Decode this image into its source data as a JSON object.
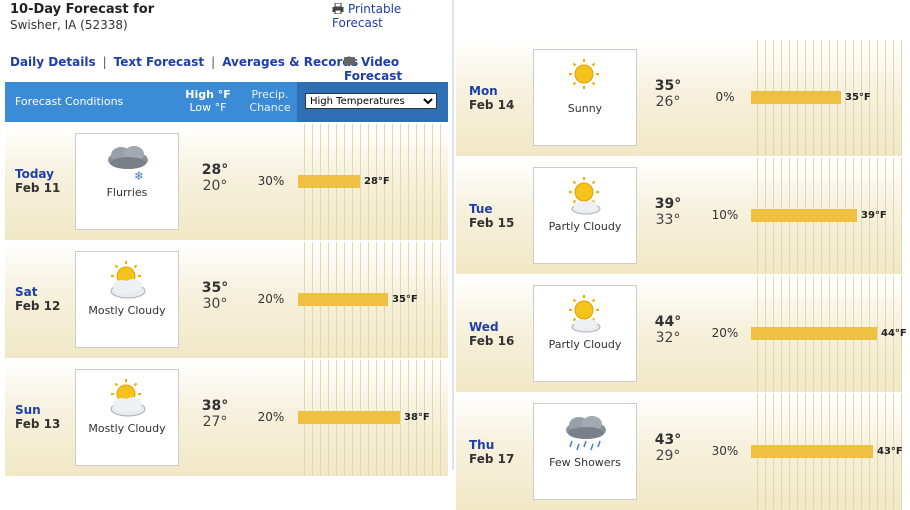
{
  "header": {
    "title": "10-Day Forecast for",
    "location": "Swisher, IA (52338)",
    "printable": "Printable Forecast"
  },
  "nav": {
    "daily": "Daily Details",
    "text": "Text Forecast",
    "averages": "Averages & Records",
    "video": "Video Forecast",
    "sep": "|"
  },
  "table_header": {
    "conditions": "Forecast Conditions",
    "high": "High °F",
    "low": "Low °F",
    "precip1": "Precip.",
    "precip2": "Chance",
    "select_value": "High Temperatures"
  },
  "colors": {
    "header_bg": "#3b8bd6",
    "link": "#1f3fa8",
    "bar": "#f0c040"
  },
  "days": [
    {
      "day": "Today",
      "date": "Feb 11",
      "cond": "Flurries",
      "icon": "snow-cloud-icon",
      "high": "28°",
      "low": "20°",
      "precip": "30%",
      "bar_value": 28,
      "bar_label": "28°F"
    },
    {
      "day": "Sat",
      "date": "Feb 12",
      "cond": "Mostly Cloudy",
      "icon": "mostly-cloudy-icon",
      "high": "35°",
      "low": "30°",
      "precip": "20%",
      "bar_value": 35,
      "bar_label": "35°F"
    },
    {
      "day": "Sun",
      "date": "Feb 13",
      "cond": "Mostly Cloudy",
      "icon": "mostly-cloudy-icon",
      "high": "38°",
      "low": "27°",
      "precip": "20%",
      "bar_value": 38,
      "bar_label": "38°F"
    },
    {
      "day": "Mon",
      "date": "Feb 14",
      "cond": "Sunny",
      "icon": "sun-icon",
      "high": "35°",
      "low": "26°",
      "precip": "0%",
      "bar_value": 35,
      "bar_label": "35°F"
    },
    {
      "day": "Tue",
      "date": "Feb 15",
      "cond": "Partly Cloudy",
      "icon": "partly-cloudy-icon",
      "high": "39°",
      "low": "33°",
      "precip": "10%",
      "bar_value": 39,
      "bar_label": "39°F"
    },
    {
      "day": "Wed",
      "date": "Feb 16",
      "cond": "Partly Cloudy",
      "icon": "partly-cloudy-icon",
      "high": "44°",
      "low": "32°",
      "precip": "20%",
      "bar_value": 44,
      "bar_label": "44°F"
    },
    {
      "day": "Thu",
      "date": "Feb 17",
      "cond": "Few Showers",
      "icon": "rain-cloud-icon",
      "high": "43°",
      "low": "29°",
      "precip": "30%",
      "bar_value": 43,
      "bar_label": "43°F"
    }
  ]
}
